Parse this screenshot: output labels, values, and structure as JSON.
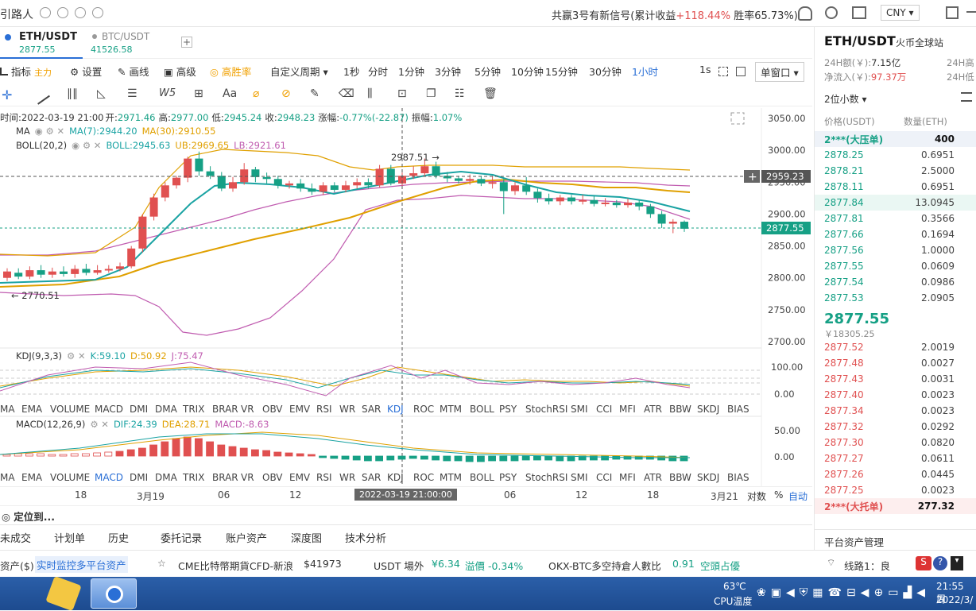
{
  "topbar": {
    "app_title": "引路人",
    "signal_text": "共赢3号有新信号(累计收益",
    "signal_gain": "+118.44%",
    "win_rate": "胜率65.73%)",
    "currency": "CNY"
  },
  "symbols": {
    "active_name": "ETH/USDT",
    "active_price": "2877.55",
    "other_name": "BTC/USDT",
    "other_price": "41526.58",
    "add_label": "+"
  },
  "toolbar": {
    "indicators_label": "指标",
    "main_label": "主力",
    "settings_label": "设置",
    "draw_label": "画线",
    "advanced_label": "高级",
    "win_rate_label": "高胜率",
    "custom_period_label": "自定义周期",
    "periods": [
      "1秒",
      "分时",
      "1分钟",
      "3分钟",
      "5分钟",
      "10分钟",
      "15分钟",
      "30分钟",
      "1小时"
    ],
    "active_period": "1小时",
    "right_period": "1s",
    "window_label": "单窗口"
  },
  "drawtools": {
    "text_tool": "Aa"
  },
  "ohlc": {
    "time_label": "时间:2022-03-19 21:00",
    "open_label": "开:",
    "open": "2971.46",
    "high_label": "高:",
    "high": "2977.00",
    "low_label": "低:",
    "low": "2945.24",
    "close_label": "收:",
    "close": "2948.23",
    "change_label": "涨幅:",
    "change": "-0.77%(-22.87)",
    "amp_label": "振幅:",
    "amp": "1.07%"
  },
  "ma": {
    "name": "MA",
    "ma7": "MA(7):2944.20",
    "ma30": "MA(30):2910.55"
  },
  "boll": {
    "name": "BOLL(20,2)",
    "boll": "BOLL:2945.63",
    "ub": "UB:2969.65",
    "lb": "LB:2921.61"
  },
  "kdj": {
    "name": "KDJ(9,3,3)",
    "k": "K:59.10",
    "d": "D:50.92",
    "j": "J:75.47"
  },
  "macd": {
    "name": "MACD(12,26,9)",
    "dif": "DIF:24.39",
    "dea": "DEA:28.71",
    "macd": "MACD:-8.63"
  },
  "indicator_tabs": [
    "MA",
    "EMA",
    "VOLUME",
    "MACD",
    "DMI",
    "DMA",
    "TRIX",
    "BRAR",
    "VR",
    "OBV",
    "EMV",
    "RSI",
    "WR",
    "SAR",
    "KDJ",
    "ROC",
    "MTM",
    "BOLL",
    "PSY",
    "StochRSI",
    "SMI",
    "CCI",
    "MFI",
    "ATR",
    "BBW",
    "SKDJ",
    "BIAS"
  ],
  "chart_labels": {
    "high_marker": "2987.51 →",
    "low_marker": "← 2770.51",
    "cursor_price": "2959.23",
    "last_price": "2877.55",
    "cursor_time": "2022-03-19 21:00:00",
    "y_ticks": [
      "3050.00",
      "3000.00",
      "2950.00",
      "2900.00",
      "2850.00",
      "2800.00",
      "2750.00",
      "2700.00"
    ],
    "kdj_ticks": [
      "100.00",
      "0.00"
    ],
    "macd_ticks": [
      "50.00",
      "0.00"
    ],
    "x_ticks": [
      "18",
      "3月19",
      "06",
      "12",
      "18",
      "06",
      "12",
      "18",
      "3月21"
    ],
    "log_label": "对数",
    "pct_label": "%",
    "auto_label": "自动",
    "locate_label": "定位到..."
  },
  "bottom_tabs": [
    "未成交",
    "计划单",
    "历史",
    "委托记录",
    "账户资产",
    "深度图",
    "技术分析"
  ],
  "right_panel": {
    "title": "ETH/USDT",
    "exchange": "火币全球站",
    "vol_label": "24H额(￥):",
    "vol_value": "7.15亿",
    "vol2_label": "24H高",
    "inflow_label": "净流入(￥):",
    "inflow_value": "97.37万",
    "low_label": "24H低",
    "decimals": "2位小数",
    "col_price": "价格(USDT)",
    "col_qty": "数量(ETH)",
    "asks_top": {
      "price": "2***(大压单)",
      "qty": "400"
    },
    "asks": [
      {
        "price": "2878.25",
        "qty": "0.6951"
      },
      {
        "price": "2878.21",
        "qty": "2.5000"
      },
      {
        "price": "2878.11",
        "qty": "0.6951"
      },
      {
        "price": "2877.84",
        "qty": "13.0945"
      },
      {
        "price": "2877.81",
        "qty": "0.3566"
      },
      {
        "price": "2877.66",
        "qty": "0.1694"
      },
      {
        "price": "2877.56",
        "qty": "1.0000"
      },
      {
        "price": "2877.55",
        "qty": "0.0609"
      },
      {
        "price": "2877.54",
        "qty": "0.0986"
      },
      {
        "price": "2877.53",
        "qty": "2.0905"
      }
    ],
    "last_price": "2877.55",
    "last_cny": "￥18305.25",
    "bids": [
      {
        "price": "2877.52",
        "qty": "2.0019"
      },
      {
        "price": "2877.48",
        "qty": "0.0027"
      },
      {
        "price": "2877.43",
        "qty": "0.0031"
      },
      {
        "price": "2877.40",
        "qty": "0.0023"
      },
      {
        "price": "2877.34",
        "qty": "0.0023"
      },
      {
        "price": "2877.32",
        "qty": "0.0292"
      },
      {
        "price": "2877.30",
        "qty": "0.0820"
      },
      {
        "price": "2877.27",
        "qty": "0.0611"
      },
      {
        "price": "2877.26",
        "qty": "0.0445"
      },
      {
        "price": "2877.25",
        "qty": "0.0023"
      }
    ],
    "bids_bottom": {
      "price": "2***(大托单)",
      "qty": "277.32"
    },
    "asset_mgmt": "平台资产管理"
  },
  "ticker": {
    "asset_label": "资产($)",
    "monitor": "实时监控多平台资产",
    "cme_label": "CME比特幣期貨CFD-新浪",
    "cme_value": "$41973",
    "usdt_label": "USDT 場外",
    "usdt_value": "¥6.34",
    "premium_label": "溢價 -0.34%",
    "okx_label": "OKX-BTC多空持倉人數比",
    "okx_value": "0.91",
    "okx_status": "空頭占優",
    "line_label": "线路1：良"
  },
  "taskbar": {
    "temp": "63℃",
    "cpu": "CPU温度",
    "time": "21:55 周",
    "date": "2022/3/"
  },
  "colors": {
    "up": "#e05050",
    "down": "#16a085",
    "accent": "#2a6fd6",
    "ma7": "#1aa3a3",
    "ma30": "#e0a000",
    "boll": "#c05cb0"
  }
}
